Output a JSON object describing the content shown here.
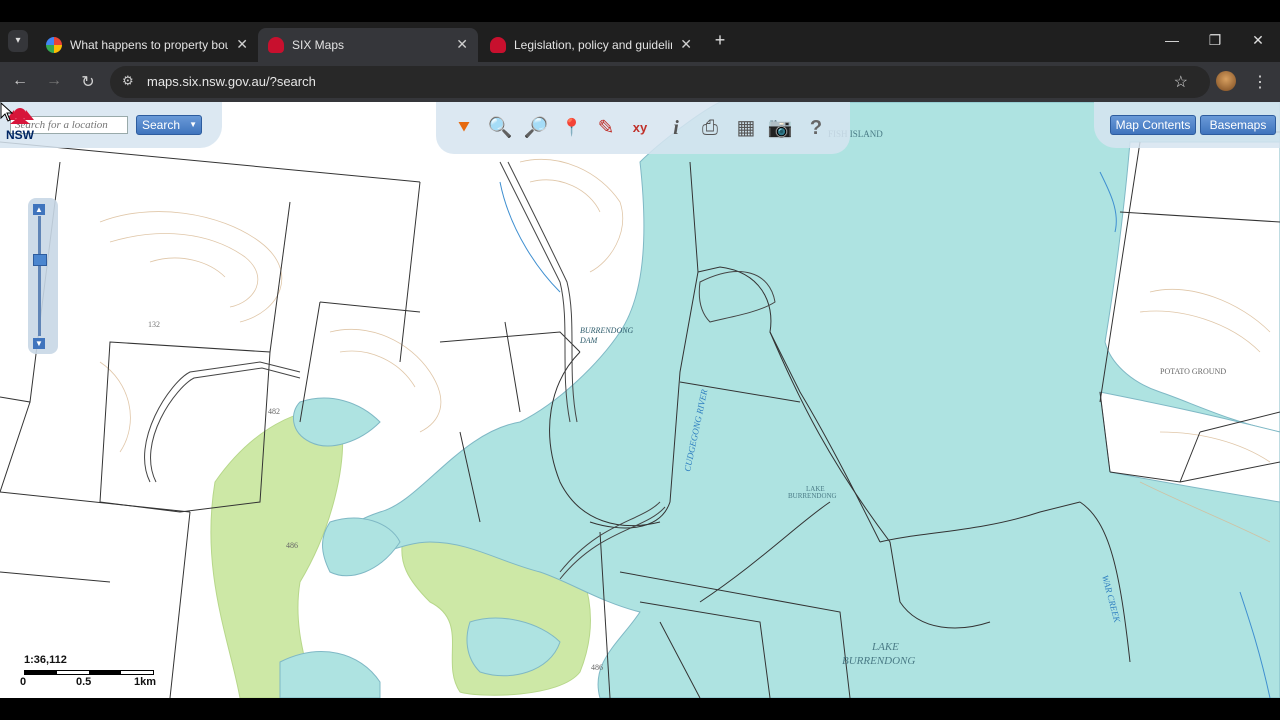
{
  "browser": {
    "tabs": [
      {
        "title": "What happens to property bou",
        "favicon": "google-icon",
        "active": false
      },
      {
        "title": "SIX Maps",
        "favicon": "nsw-waratah-icon",
        "active": true
      },
      {
        "title": "Legislation, policy and guideline",
        "favicon": "nsw-waratah-icon",
        "active": false
      }
    ],
    "url": "maps.six.nsw.gov.au/?search",
    "close_glyph": "✕",
    "new_tab_glyph": "+"
  },
  "map_app": {
    "search": {
      "placeholder": "Search for a location",
      "button_label": "Search"
    },
    "tools": [
      "basemap-chevron-icon",
      "zoom-in-magnifier-icon",
      "zoom-out-magnifier-icon",
      "measure-pin-icon",
      "draw-edit-icon",
      "coordinate-xy-icon",
      "info-icon",
      "print-preview-icon",
      "table-icon",
      "camera-icon",
      "help-icon"
    ],
    "map_contents_label": "Map Contents",
    "basemaps_label": "Basemaps",
    "scale": {
      "ratio": "1:36,112",
      "ticks": [
        "0",
        "0.5",
        "1km"
      ]
    },
    "labels": {
      "dam": [
        "BURRENDONG",
        "DAM"
      ],
      "river": "CUDGEGONG RIVER",
      "lake_small": [
        "LAKE",
        "BURRENDONG"
      ],
      "lake_large": [
        "LAKE",
        "BURRENDONG"
      ],
      "island": "FISH ISLAND",
      "potato": "POTATO GROUND",
      "spot_heights": [
        "132",
        "482",
        "486",
        "486"
      ]
    },
    "logo_text": "NSW",
    "colors": {
      "water": "#aee3e1",
      "vegetation": "#cde8a6",
      "roads": "#444444",
      "accent_blue": "#3f74bd"
    }
  }
}
